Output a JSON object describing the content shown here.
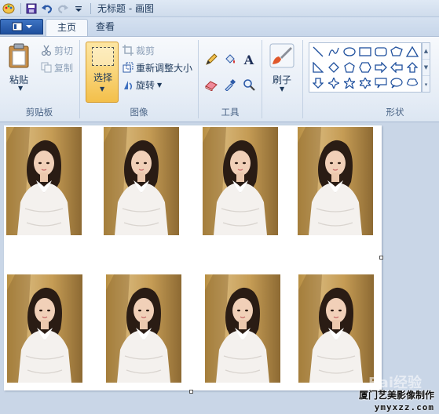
{
  "window": {
    "title": "无标题 - 画图"
  },
  "tabs": [
    {
      "label": "主页"
    },
    {
      "label": "查看"
    }
  ],
  "clipboard": {
    "paste_label": "粘贴",
    "cut_label": "剪切",
    "copy_label": "复制",
    "group_label": "剪贴板"
  },
  "image": {
    "select_label": "选择",
    "crop_label": "裁剪",
    "resize_label": "重新调整大小",
    "rotate_label": "旋转",
    "group_label": "图像"
  },
  "tools": {
    "group_label": "工具",
    "text_glyph": "A"
  },
  "brushes": {
    "label": "刷子"
  },
  "shapes": {
    "group_label": "形状"
  },
  "canvas": {
    "photo_count": 8
  },
  "watermark": {
    "text": "厦门艺美影像制作",
    "url": "ymyxzz.com",
    "logo": "Bai经验"
  },
  "colors": {
    "ribbon_accent": "#1e4f9d",
    "select_highlight": "#f9d57a"
  }
}
